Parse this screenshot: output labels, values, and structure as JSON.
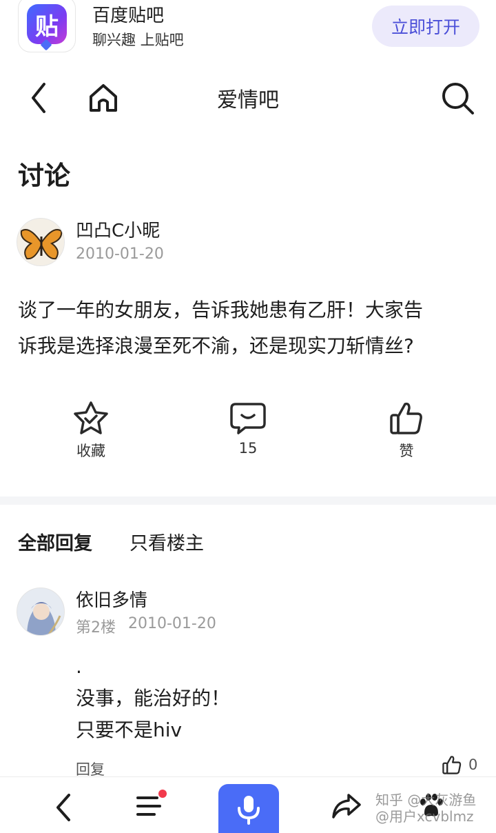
{
  "banner": {
    "logo_char": "贴",
    "app_name": "百度贴吧",
    "slogan": "聊兴趣 上贴吧",
    "open_label": "立即打开"
  },
  "nav": {
    "title": "爱情吧"
  },
  "section_title": "讨论",
  "post": {
    "author": "凹凸C小昵",
    "date": "2010-01-20",
    "body_line1": "谈了一年的女朋友，告诉我她患有乙肝！大家告",
    "body_line2": "诉我是选择浪漫至死不渝，还是现实刀斩情丝?"
  },
  "actions": {
    "favorite_label": "收藏",
    "comment_count": "15",
    "like_label": "赞"
  },
  "tabs": {
    "all_replies": "全部回复",
    "op_only": "只看楼主"
  },
  "reply": {
    "author": "依旧多情",
    "floor": "第2楼",
    "date": "2010-01-20",
    "line1": ".",
    "line2": "没事，能治好的！",
    "line3": "只要不是hiv",
    "reply_label": "回复",
    "like_count": "0"
  },
  "watermark": {
    "line1": "知乎 @大灰游鱼",
    "line2": "@用户xcvblmz"
  },
  "colors": {
    "accent": "#4a6cf7",
    "open_button_bg": "#eceafb",
    "notification_dot": "#f23a4c",
    "meta_text": "#9a9a9a"
  }
}
